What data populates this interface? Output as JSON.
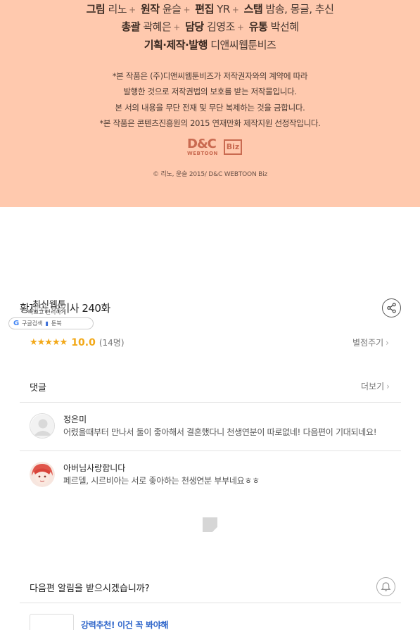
{
  "credits": {
    "line1": [
      {
        "role": "그림",
        "name": "리노"
      },
      {
        "role": "원작",
        "name": "윤슬"
      },
      {
        "role": "편집",
        "name": "YR"
      },
      {
        "role": "스탭",
        "name": "밤송, 몽글, 추신"
      }
    ],
    "line2": [
      {
        "role": "총괄",
        "name": "곽혜은"
      },
      {
        "role": "담당",
        "name": "김영조"
      },
      {
        "role": "유통",
        "name": "박선혜"
      }
    ],
    "line3": {
      "role": "기획·제작·발행",
      "name": "디앤씨웹툰비즈"
    },
    "separator": "+",
    "notes": [
      "*본 작품은 (주)디앤씨웹툰비즈가 저작권자와의 계약에 따라",
      "발행한 것으로 저작권법의 보호를 받는 저작물입니다.",
      "본 서의 내용을 무단 전재 및 무단 복제하는 것을 금합니다.",
      "*본 작품은 콘텐츠진흥원의 2015 연재만화 제작지원 선정작입니다."
    ],
    "logo": {
      "main": "D&C",
      "sub": "WEBTOON",
      "badge": "Biz"
    },
    "copyright": "© 리노, 윤슬 2015/ D&C WEBTOON Biz",
    "bg_color": "#ffc9ae"
  },
  "episode": {
    "title": "황제와 여기사 240화",
    "share_icon": "share-icon"
  },
  "overlay": {
    "title": "최신웹툰",
    "subtitle": "빠르고 편리하게",
    "google_label": "구글검색",
    "toonbook_label": "툰북"
  },
  "rating": {
    "stars": "★★★★★",
    "score": "10.0",
    "count": "(14명)",
    "rate_label": "별점주기",
    "chevron": "›"
  },
  "comments": {
    "header": "댓글",
    "more_label": "더보기",
    "chevron": "›",
    "items": [
      {
        "author": "정은미",
        "body": "어렸을때부터 만나서 둘이 좋아해서 결혼했다니 천생연분이 따로없네! 다음편이 기대되네요!",
        "avatar": "blank"
      },
      {
        "author": "아버님사랑합니다",
        "body": "페르델, 시르비아는 서로 좋아하는 천생연분 부부네요ㅎㅎ",
        "avatar": "character"
      }
    ]
  },
  "notify": {
    "question": "다음편 알림을 받으시겠습니까?",
    "icon": "bell-icon"
  },
  "recommend": {
    "label": "강력추천! 이건 꼭 봐야해"
  },
  "colors": {
    "star": "#f2a818",
    "link": "#2b63c9",
    "divider": "#e2e2e2"
  }
}
